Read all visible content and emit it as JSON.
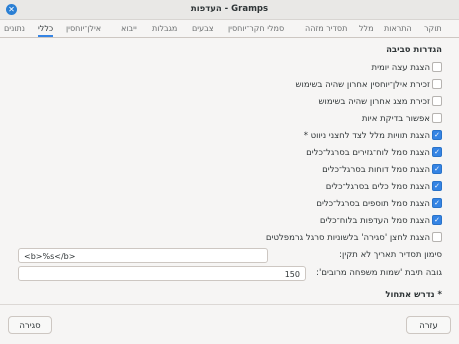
{
  "window": {
    "title": "העדפות - Gramps",
    "close_glyph": "✕"
  },
  "tabs": [
    {
      "label": "נתונים",
      "active": false
    },
    {
      "label": "כללי",
      "active": true
    },
    {
      "label": "אילן־יוחסין",
      "active": false
    },
    {
      "label": "ייבוא",
      "active": false
    },
    {
      "label": "מגבלות",
      "active": false
    },
    {
      "label": "צבעים",
      "active": false
    },
    {
      "label": "סמלי חקר־יוחסין",
      "active": false
    },
    {
      "label": "תסדיר מזהה",
      "active": false
    },
    {
      "label": "מלל",
      "active": false
    },
    {
      "label": "התראות",
      "active": false
    },
    {
      "label": "תוקר",
      "active": false
    }
  ],
  "section": {
    "title": "הגדרות סביבה"
  },
  "options": [
    {
      "label": "הצגת עצה יומית",
      "checked": false
    },
    {
      "label": "זכירת אילן־יוחסין אחרון שהיה בשימוש",
      "checked": false
    },
    {
      "label": "זכירת מצג אחרון שהיה בשימוש",
      "checked": false
    },
    {
      "label": "אפשור בדיקת איות",
      "checked": false
    },
    {
      "label": "הצגת תוויות מלל לצד לחצני ניווט *",
      "checked": true
    },
    {
      "label": "הצגת סמל לוח־גזירים בסרגל־כלים",
      "checked": true
    },
    {
      "label": "הצגת סמל דוחות בסרגל־כלים",
      "checked": true
    },
    {
      "label": "הצגת סמל כלים בסרגל־כלים",
      "checked": true
    },
    {
      "label": "הצגת סמל תוספים בסרגל־כלים",
      "checked": true
    },
    {
      "label": "הצגת סמל העדפות בלוח־כלים",
      "checked": true
    },
    {
      "label": "הצגת לחצן 'סגירה' בלשוניות סרגל גרמפלטים",
      "checked": false
    }
  ],
  "fields": {
    "date_marker_label": "סימון תסדיר תאריך לא תקין:",
    "date_marker_value": "<b>%s</b>",
    "surname_height_label": "גובה תיבת 'שמות משפחה מרובים':",
    "surname_height_value": "150"
  },
  "footnote": "* נדרש אתחול",
  "buttons": {
    "close": "סגירה",
    "help": "עזרה"
  },
  "colors": {
    "accent": "#3584e4",
    "close_button": "#2a7fd4"
  },
  "check_glyph": "✓"
}
